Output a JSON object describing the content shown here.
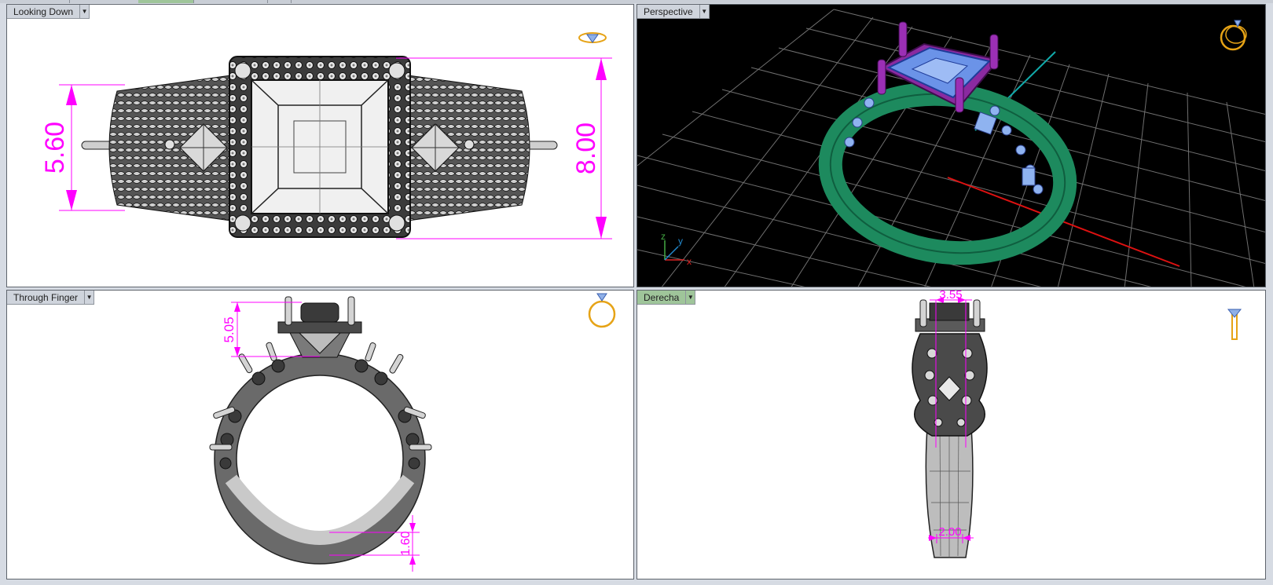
{
  "viewports": {
    "top_left": {
      "label": "Looking Down"
    },
    "top_right": {
      "label": "Perspective"
    },
    "bottom_left": {
      "label": "Through Finger"
    },
    "bottom_right": {
      "label": "Derecha"
    }
  },
  "dimensions": {
    "looking_down_left": "5.60",
    "looking_down_right": "8.00",
    "through_finger_top": "5.05",
    "through_finger_bottom": "1.60",
    "derecha_top": "3.55",
    "derecha_bottom": "2.00"
  },
  "axes": {
    "x": "x",
    "y": "y",
    "z": "z"
  },
  "colors": {
    "dimension": "#ff00ff",
    "active_tab": "#9fc59a",
    "prongs": "#8a2aa0",
    "stone": "#6b93e8",
    "shank": "#1d8a5e",
    "grid": "#7c7c7c"
  },
  "icons": [
    "dropdown-arrow-icon",
    "ring-view-icon"
  ]
}
